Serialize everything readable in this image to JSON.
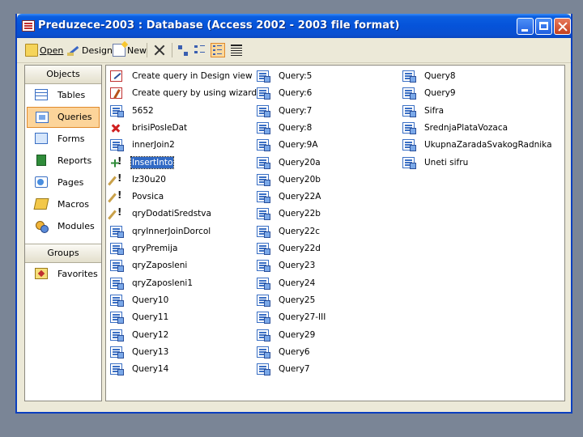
{
  "window": {
    "title": "Preduzece-2003 : Database (Access 2002 - 2003 file format)"
  },
  "toolbar": {
    "open_label": "Open",
    "design_label": "Design",
    "new_label": "New"
  },
  "sidebar": {
    "objects_header": "Objects",
    "items": [
      {
        "label": "Tables",
        "icon": "table-icon"
      },
      {
        "label": "Queries",
        "icon": "query-icon"
      },
      {
        "label": "Forms",
        "icon": "form-icon"
      },
      {
        "label": "Reports",
        "icon": "report-icon"
      },
      {
        "label": "Pages",
        "icon": "page-icon"
      },
      {
        "label": "Macros",
        "icon": "macro-icon"
      },
      {
        "label": "Modules",
        "icon": "module-icon"
      }
    ],
    "selected": "Queries",
    "groups_header": "Groups",
    "groups": [
      {
        "label": "Favorites",
        "icon": "favorites-icon"
      }
    ]
  },
  "content": {
    "col1": [
      {
        "label": "Create query in Design view",
        "icon": "create-design"
      },
      {
        "label": "Create query by using wizard",
        "icon": "create-wizard"
      },
      {
        "label": "5652",
        "icon": "qicon"
      },
      {
        "label": "brisiPosleDat",
        "icon": "delete-q"
      },
      {
        "label": "innerJoin2",
        "icon": "qicon"
      },
      {
        "label": "InsertInto",
        "icon": "append-q"
      },
      {
        "label": "Iz30u20",
        "icon": "update-q"
      },
      {
        "label": "Povsica",
        "icon": "update-q"
      },
      {
        "label": "qryDodatiSredstva",
        "icon": "update-q"
      },
      {
        "label": "qryInnerJoinDorcol",
        "icon": "qicon"
      },
      {
        "label": "qryPremija",
        "icon": "qicon"
      },
      {
        "label": "qryZaposleni",
        "icon": "qicon"
      },
      {
        "label": "qryZaposleni1",
        "icon": "qicon"
      },
      {
        "label": "Query10",
        "icon": "qicon"
      },
      {
        "label": "Query11",
        "icon": "qicon"
      },
      {
        "label": "Query12",
        "icon": "qicon"
      },
      {
        "label": "Query13",
        "icon": "qicon"
      },
      {
        "label": "Query14",
        "icon": "qicon"
      }
    ],
    "col2": [
      {
        "label": "Query:5",
        "icon": "qicon"
      },
      {
        "label": "Query:6",
        "icon": "qicon"
      },
      {
        "label": "Query:7",
        "icon": "qicon"
      },
      {
        "label": "Query:8",
        "icon": "qicon"
      },
      {
        "label": "Query:9A",
        "icon": "qicon"
      },
      {
        "label": "Query20a",
        "icon": "qicon"
      },
      {
        "label": "Query20b",
        "icon": "qicon"
      },
      {
        "label": "Query22A",
        "icon": "qicon"
      },
      {
        "label": "Query22b",
        "icon": "qicon"
      },
      {
        "label": "Query22c",
        "icon": "qicon"
      },
      {
        "label": "Query22d",
        "icon": "qicon"
      },
      {
        "label": "Query23",
        "icon": "qicon"
      },
      {
        "label": "Query24",
        "icon": "qicon"
      },
      {
        "label": "Query25",
        "icon": "qicon"
      },
      {
        "label": "Query27-III",
        "icon": "qicon"
      },
      {
        "label": "Query29",
        "icon": "qicon"
      },
      {
        "label": "Query6",
        "icon": "qicon"
      },
      {
        "label": "Query7",
        "icon": "qicon"
      }
    ],
    "col3": [
      {
        "label": "Query8",
        "icon": "qicon"
      },
      {
        "label": "Query9",
        "icon": "qicon"
      },
      {
        "label": "Sifra",
        "icon": "qicon"
      },
      {
        "label": "SrednjaPlataVozaca",
        "icon": "qicon"
      },
      {
        "label": "UkupnaZaradaSvakogRadnika",
        "icon": "qicon"
      },
      {
        "label": "Uneti sifru",
        "icon": "qicon"
      }
    ],
    "selected": "InsertInto"
  }
}
